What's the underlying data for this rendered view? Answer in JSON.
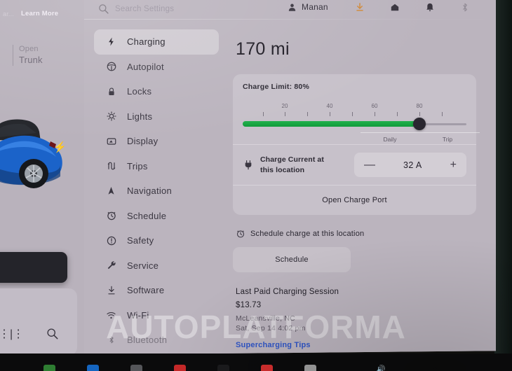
{
  "topbar": {
    "search_placeholder": "Search Settings",
    "search_value": "",
    "search_icon": "search-icon",
    "account_name": "Manan",
    "account_icon": "person-icon",
    "status_icons": [
      "software-download-icon",
      "garage-home-icon",
      "notification-bell-icon",
      "bluetooth-icon",
      "cellular-signal-icon"
    ]
  },
  "car_panel": {
    "label_line1": "Open",
    "label_line2": "Trunk",
    "bolt_icon": "charge-bolt-icon",
    "toast_text": "ar...",
    "learn_more_label": "Learn More",
    "sliders_icon": "sliders-icon",
    "magnifier_icon": "search-icon"
  },
  "sidebar": {
    "items": [
      {
        "label": "Charging",
        "icon": "bolt-icon",
        "active": true,
        "dim": false
      },
      {
        "label": "Autopilot",
        "icon": "steering-wheel-icon",
        "active": false,
        "dim": false
      },
      {
        "label": "Locks",
        "icon": "lock-icon",
        "active": false,
        "dim": false
      },
      {
        "label": "Lights",
        "icon": "light-bulb-icon",
        "active": false,
        "dim": false
      },
      {
        "label": "Display",
        "icon": "display-icon",
        "active": false,
        "dim": false
      },
      {
        "label": "Trips",
        "icon": "route-icon",
        "active": false,
        "dim": false
      },
      {
        "label": "Navigation",
        "icon": "navigation-arrow-icon",
        "active": false,
        "dim": false
      },
      {
        "label": "Schedule",
        "icon": "alarm-clock-icon",
        "active": false,
        "dim": false
      },
      {
        "label": "Safety",
        "icon": "exclamation-circle-icon",
        "active": false,
        "dim": false
      },
      {
        "label": "Service",
        "icon": "wrench-icon",
        "active": false,
        "dim": false
      },
      {
        "label": "Software",
        "icon": "download-icon",
        "active": false,
        "dim": false
      },
      {
        "label": "Wi-Fi",
        "icon": "wifi-icon",
        "active": false,
        "dim": false
      },
      {
        "label": "Bluetooth",
        "icon": "bluetooth-icon",
        "active": false,
        "dim": true
      }
    ]
  },
  "charging": {
    "range": "170 mi",
    "charge_limit_label": "Charge Limit: 80%",
    "charge_limit_percent": 80,
    "slider": {
      "min": 0,
      "max": 100,
      "value": 80,
      "tick_labels": [
        "20",
        "40",
        "60",
        "80"
      ],
      "tick_values": [
        20,
        40,
        60,
        80
      ],
      "minor_ticks": [
        10,
        20,
        30,
        40,
        50,
        60,
        70,
        80,
        90
      ],
      "mode_labels": [
        "Daily",
        "Trip"
      ],
      "fill_color": "#1aa94a",
      "thumb_color": "#2a2730"
    },
    "charge_current": {
      "icon": "plug-icon",
      "label_line1": "Charge Current at",
      "label_line2": "this location",
      "decrement": "—",
      "value": "32 A",
      "increment": "+"
    },
    "open_charge_port_label": "Open Charge Port",
    "schedule": {
      "icon": "alarm-clock-icon",
      "heading": "Schedule charge at this location",
      "button_label": "Schedule"
    },
    "last_session": {
      "heading": "Last Paid Charging Session",
      "amount": "$13.73",
      "location": "McLeansville, NC",
      "datetime": "Sat, Sep 14 4:02 pm"
    },
    "supercharging_tips_label": "Supercharging Tips",
    "link_color": "#2f55c6"
  },
  "watermark": {
    "text": "AUTOPLATFORMA"
  },
  "taskbar": {
    "icon_colors": [
      "#2e7d32",
      "#1565c0",
      "#55565a",
      "#c62828",
      "#1b1b1d",
      "#d32f2f",
      "#9e9e9e"
    ],
    "volume_icon": "volume-icon"
  }
}
